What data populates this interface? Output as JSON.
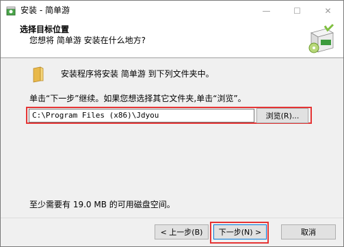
{
  "window": {
    "title": "安装 - 简单游",
    "minimize_symbol": "—",
    "maximize_symbol": "☐",
    "close_symbol": "✕"
  },
  "header": {
    "title": "选择目标位置",
    "subtitle": "您想将 简单游 安装在什么地方?"
  },
  "body": {
    "install_info": "安装程序将安装 简单游 到下列文件夹中。",
    "instruction": "单击“下一步”继续。如果您想选择其它文件夹,单击“浏览”。",
    "path_value": "C:\\Program Files (x86)\\Jdyou",
    "browse_label": "浏览(R)...",
    "disk_space": "至少需要有 19.0 MB 的可用磁盘空间。"
  },
  "footer": {
    "back_label": "< 上一步(B)",
    "next_label": "下一步(N) >",
    "cancel_label": "取消"
  },
  "icons": {
    "app": "installer-app-icon",
    "logo": "product-box-logo-icon",
    "folder": "folder-icon"
  },
  "colors": {
    "highlight": "#e53333",
    "focus": "#0078d7"
  }
}
